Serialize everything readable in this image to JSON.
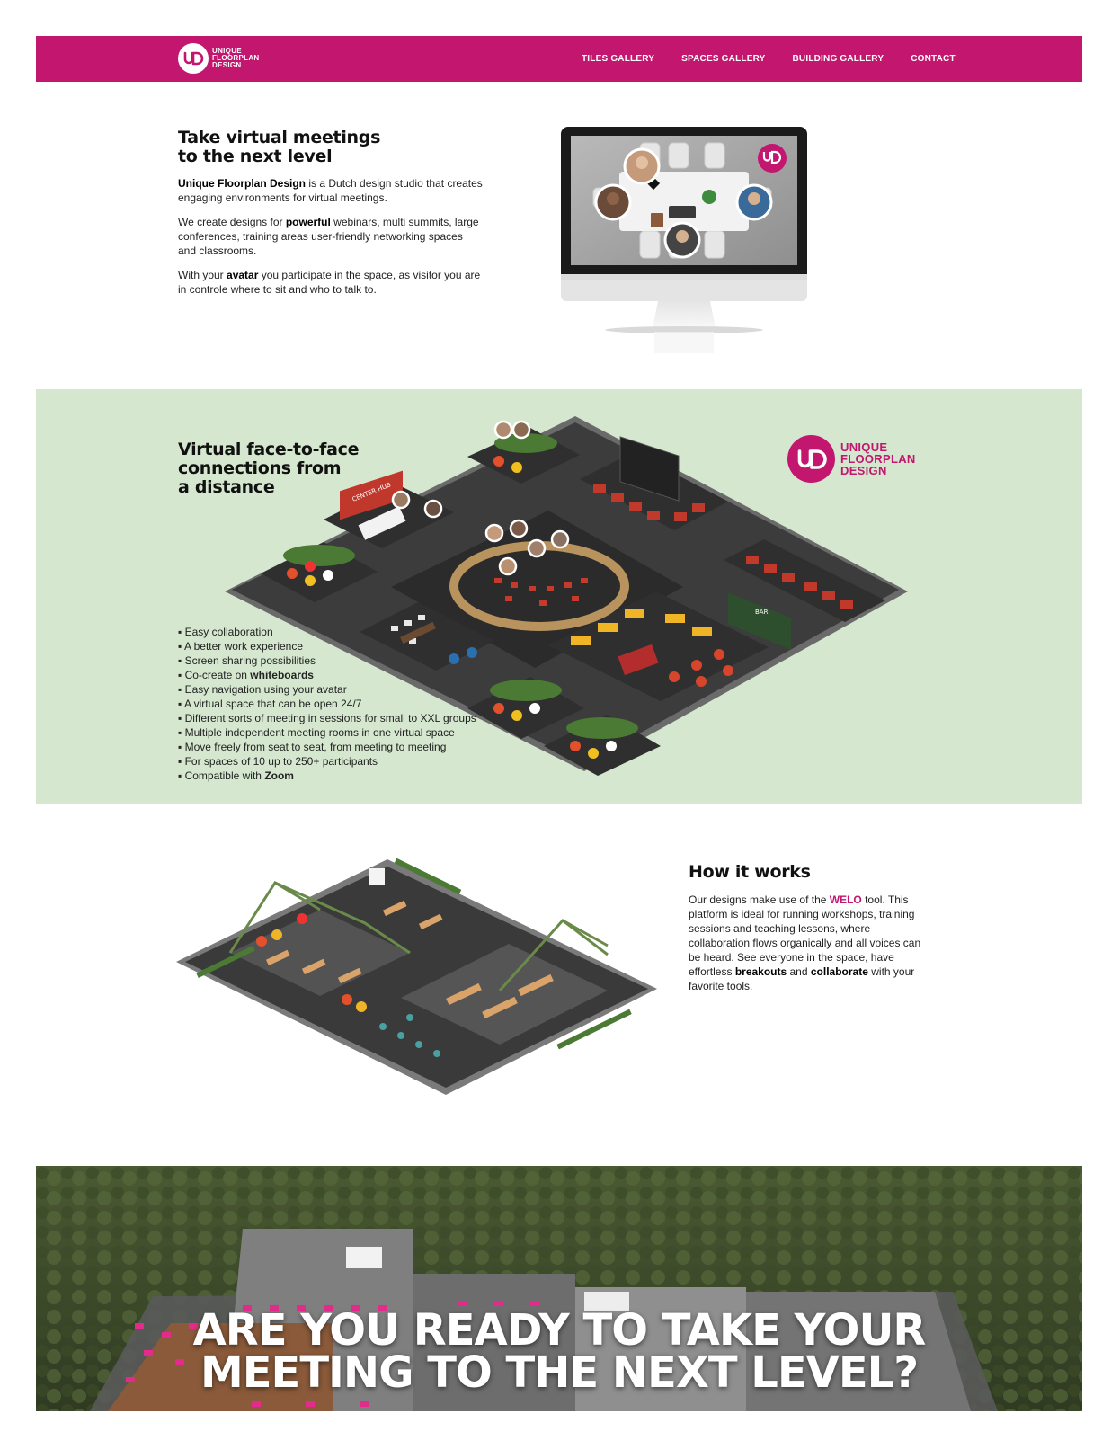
{
  "brand": {
    "name_lines": [
      "UNIQUE",
      "FLOORPLAN",
      "DESIGN"
    ],
    "primary_color": "#c2166f",
    "accent_green": "#d5e8cf"
  },
  "nav": {
    "items": [
      {
        "label": "TILES GALLERY"
      },
      {
        "label": "SPACES GALLERY"
      },
      {
        "label": "BUILDING GALLERY"
      },
      {
        "label": "CONTACT"
      }
    ]
  },
  "intro": {
    "title_line1": "Take virtual meetings",
    "title_line2": "to the next level",
    "p1_bold": "Unique Floorplan Design",
    "p1_rest": " is a Dutch design studio that creates engaging environments for virtual meetings.",
    "p2_a": "We create designs for ",
    "p2_bold": "powerful",
    "p2_b": " webinars, multi summits, large conferences, training areas user-friendly networking spaces and classrooms.",
    "p3_a": "With your ",
    "p3_bold": "avatar",
    "p3_b": " you participate in the space, as visitor you are in controle where to sit and who to talk to."
  },
  "features": {
    "title_line1": "Virtual face-to-face",
    "title_line2": "connections from",
    "title_line3": "a distance",
    "items": [
      {
        "text": "Easy collaboration",
        "bold": ""
      },
      {
        "text": "A better work experience",
        "bold": ""
      },
      {
        "text": "Screen sharing possibilities",
        "bold": ""
      },
      {
        "text": "Co-create on ",
        "bold": "whiteboards"
      },
      {
        "text": "Easy navigation using your avatar",
        "bold": ""
      },
      {
        "text": "A virtual space that can be open 24/7",
        "bold": ""
      },
      {
        "text": "Different sorts of meeting in sessions for small to XXL groups",
        "bold": ""
      },
      {
        "text": "Multiple independent meeting rooms in one virtual space",
        "bold": ""
      },
      {
        "text": "Move freely from seat to seat, from meeting to meeting",
        "bold": ""
      },
      {
        "text": "For spaces of 10 up to 250+ participants",
        "bold": ""
      },
      {
        "text": "Compatible with ",
        "bold": "Zoom"
      }
    ],
    "map_labels": {
      "hub": "CENTER HUB",
      "bar": "BAR"
    }
  },
  "how": {
    "title": "How it works",
    "p_a": "Our designs make use of the ",
    "p_welo": "WELO",
    "p_b": " tool. This platform is ideal for running workshops, training sessions and teaching lessons, where collaboration flows organically and all voices can be heard. See everyone in the space, have effortless ",
    "p_bold1": "breakouts",
    "p_c": " and ",
    "p_bold2": "collaborate",
    "p_d": " with your favorite tools."
  },
  "banner": {
    "line1": "ARE YOU READY TO TAKE YOUR",
    "line2": "MEETING TO THE NEXT LEVEL?"
  }
}
